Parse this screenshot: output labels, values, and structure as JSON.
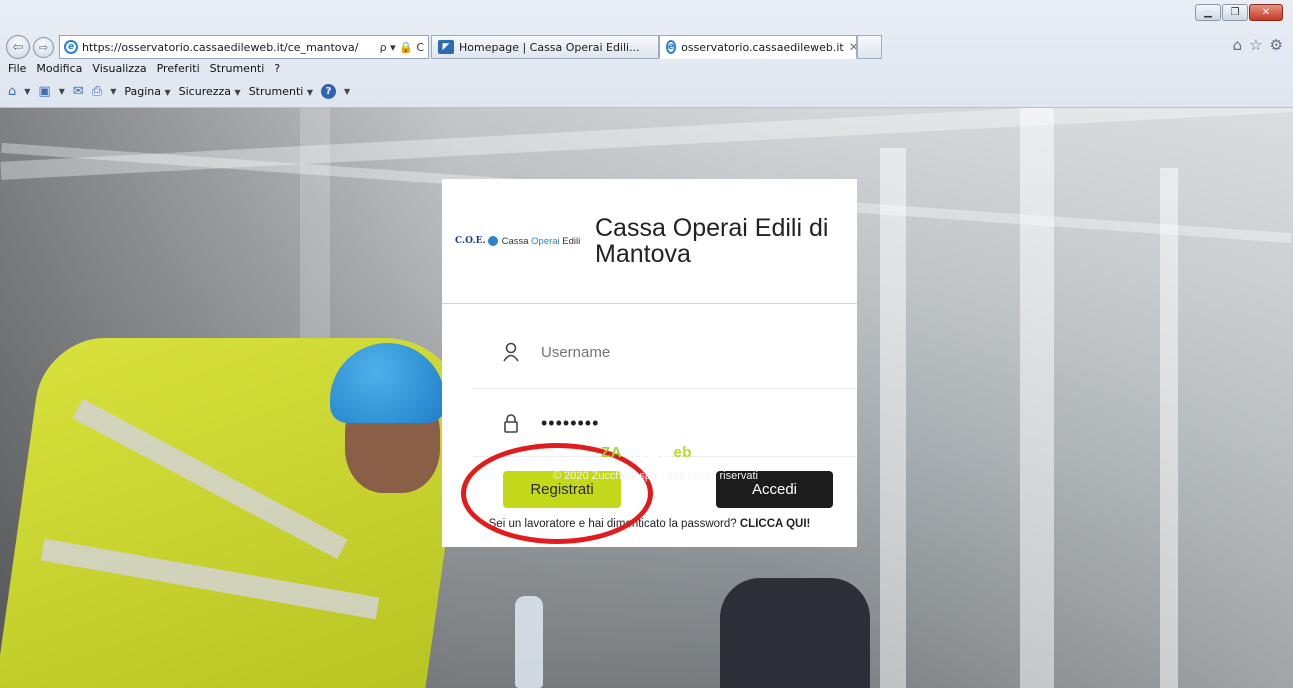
{
  "browser": {
    "address_url": "https://osservatorio.cassaedileweb.it/ce_mantova/",
    "address_tools": "ρ ▾ 🔒 C",
    "tabs": [
      {
        "label": "Homepage | Cassa Operai Edili...",
        "favicon": "site-favicon"
      },
      {
        "label": "osservatorio.cassaedileweb.it",
        "favicon": "ie-favicon",
        "close": "✕"
      }
    ],
    "menu": [
      "File",
      "Modifica",
      "Visualizza",
      "Preferiti",
      "Strumenti",
      "?"
    ],
    "command_bar": {
      "pagina": "Pagina",
      "sicurezza": "Sicurezza",
      "strumenti": "Strumenti"
    }
  },
  "login": {
    "logo": {
      "mark": "C.O.E.",
      "text_prefix": "Cassa ",
      "text_accent": "Operai",
      "text_suffix": " Edili"
    },
    "title": "Cassa Operai Edili di Mantova",
    "username_placeholder": "Username",
    "password_value": "••••••••",
    "register_label": "Registrati",
    "login_label": "Accedi",
    "forgot_text": "Sei un lavoratore e hai dimenticato la password?",
    "forgot_link": "CLICCA QUI!"
  },
  "footer": {
    "brand_prefix": "ZA",
    "brand_middle": "SICEW",
    "brand_suffix": "eb",
    "copyright": "© 2020 Zucchetti spa - tutti i diritti riservati"
  },
  "colors": {
    "register_button": "#c4d81a",
    "login_button": "#1c1c1c",
    "highlight": "#e21c1c"
  }
}
